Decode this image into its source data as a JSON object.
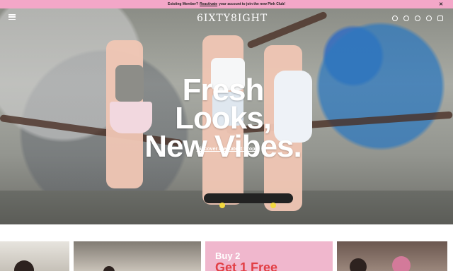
{
  "announcement": {
    "prefix": "Existing Member?",
    "link": "Reactivate",
    "suffix": "your account to join the new Pink Club!",
    "close_icon": "close-icon"
  },
  "header": {
    "menu_icon": "menu-icon",
    "logo_text": "6IXTY8IGHT",
    "icons": [
      "globe-icon",
      "search-icon",
      "user-icon",
      "heart-icon",
      "bag-icon"
    ]
  },
  "hero": {
    "title_line1": "Fresh Looks,",
    "title_line2": "New Vibes.",
    "cta": "Discover the Latest Drops"
  },
  "promo_cards": {
    "card3_line1": "Buy 2",
    "card3_line2": "Get 1 Free"
  },
  "colors": {
    "announcement_bg": "#f3a7c8",
    "promo_card_bg": "#f0b7cd",
    "promo_text": "#e23f45"
  }
}
